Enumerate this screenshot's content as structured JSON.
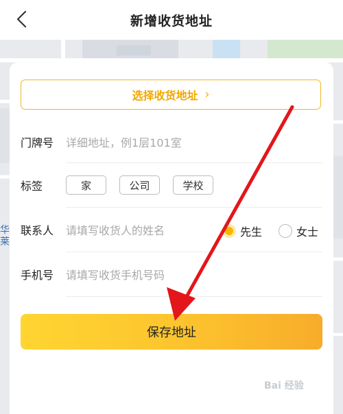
{
  "header": {
    "title": "新增收货地址",
    "back_icon": "chevron-left-icon"
  },
  "map": {
    "label": "华山\n莱尔"
  },
  "form": {
    "select_address_label": "选择收货地址",
    "select_address_chevron": "›",
    "door_label": "门牌号",
    "door_placeholder": "详细地址，例1层101室",
    "tag_label": "标签",
    "tags": [
      "家",
      "公司",
      "学校"
    ],
    "contact_label": "联系人",
    "contact_placeholder": "请填写收货人的姓名",
    "gender_male": "先生",
    "gender_female": "女士",
    "gender_selected": "先生",
    "phone_label": "手机号",
    "phone_placeholder": "请填写收货手机号码",
    "save_label": "保存地址"
  },
  "colors": {
    "accent": "#f0a800",
    "annotation_arrow": "#e3161b"
  },
  "watermark": "Bai 经验"
}
